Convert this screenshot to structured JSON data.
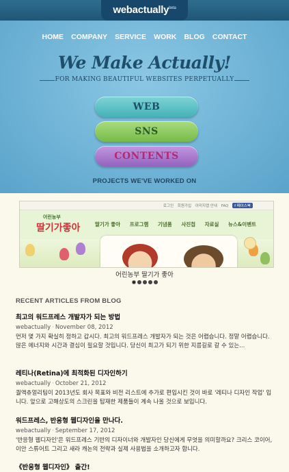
{
  "header": {
    "logo_text": "webactually",
    "logo_superscript": "beta",
    "colors": {
      "bar": "#2f6d8f",
      "logo_tab": "#17476a"
    }
  },
  "nav": {
    "items": [
      "HOME",
      "COMPANY",
      "SERVICE",
      "WORK",
      "BLOG",
      "CONTACT"
    ]
  },
  "hero": {
    "headline": "We Make Actually!",
    "tagline": "FOR MAKING BEAUTIFUL WEBSITES PERPETUALLY",
    "buttons": [
      {
        "label": "WEB",
        "color": "#45b2b8"
      },
      {
        "label": "SNS",
        "color": "#77bb4a"
      },
      {
        "label": "CONTENTS",
        "color": "#9463bf"
      }
    ],
    "projects_heading": "PROJECTS WE'VE WORKED ON"
  },
  "project_preview": {
    "top_links": [
      "로그인",
      "회원가입",
      "이미지맵 안내",
      "FAQ"
    ],
    "fb_label": "f 페이스북",
    "logo_small": "어린농부",
    "logo_big": "딸기가좋아",
    "menu": [
      "딸기가 좋아",
      "프로그램",
      "기념품",
      "사진첩",
      "자료실",
      "뉴스&이벤트"
    ],
    "caption": "어린농부 딸기가 좋아",
    "slide_count": 5,
    "active_slide": 1
  },
  "blog": {
    "heading": "RECENT ARTICLES FROM BLOG",
    "articles": [
      {
        "title": "최고의 워드프레스 개발자가 되는 방법",
        "author": "webactually",
        "date": "November 08, 2012",
        "excerpt": "먼저 몇 가지 확실히 정하고 갑시다. 최고의 워드프레스 개발자가 되는 것은 어렵습니다. 정말 어렵습니다. 많은 에너지와 시간과 결심이 필요할 것입니다. 당신이 최고가 되기 위한 지름길로 갈 수 있는..."
      },
      {
        "title": "레티나(Retina)에 최적화된 디자인하기",
        "author": "webactually",
        "date": "October 21, 2012",
        "excerpt": "퀄액츄얼리팀이 2013년도 회사 목표와 비전 리스트에 추가로 편입시킨 것이 바로 '레티나 디자인 작업' 입니다. 앞으로 고해상도의 스크린을 탑재한 제품들이 계속 나올 것으로 보입니다."
      },
      {
        "title": "워드프레스, 반응형 웹디자인을 만나다.",
        "author": "webactually",
        "date": "September 17, 2012",
        "excerpt": "'반응형 웹디자인'은 워드프레스 기반의 디자이너와 개발자인 당신에게 무엇을 의미할까요? 크리스 코이어, 이안 스튜어트 그리고 새라 캐논의 전략과 실제 사용법을 소개하고자 합니다."
      },
      {
        "title": "《반응형 웹디자인》 출간!"
      }
    ]
  }
}
